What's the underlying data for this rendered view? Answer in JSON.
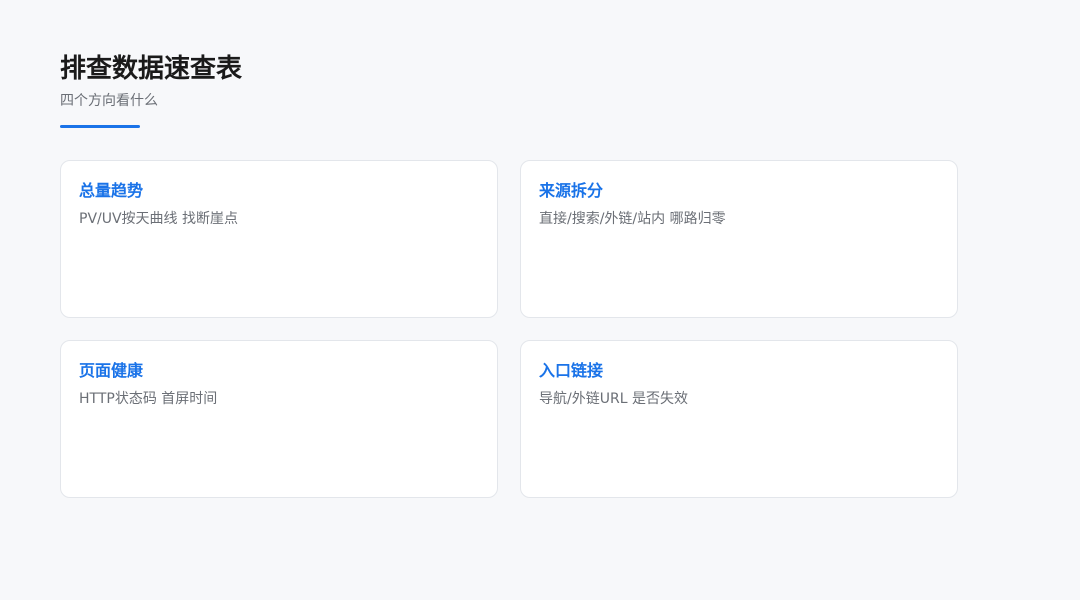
{
  "header": {
    "title": "排查数据速查表",
    "subtitle": "四个方向看什么"
  },
  "colors": {
    "accent": "#1a73e8",
    "background": "#f7f8fa",
    "card_border": "#e3e6eb"
  },
  "cards": [
    {
      "title": "总量趋势",
      "desc": "PV/UV按天曲线 找断崖点"
    },
    {
      "title": "来源拆分",
      "desc": "直接/搜索/外链/站内 哪路归零"
    },
    {
      "title": "页面健康",
      "desc": "HTTP状态码 首屏时间"
    },
    {
      "title": "入口链接",
      "desc": "导航/外链URL 是否失效"
    }
  ]
}
